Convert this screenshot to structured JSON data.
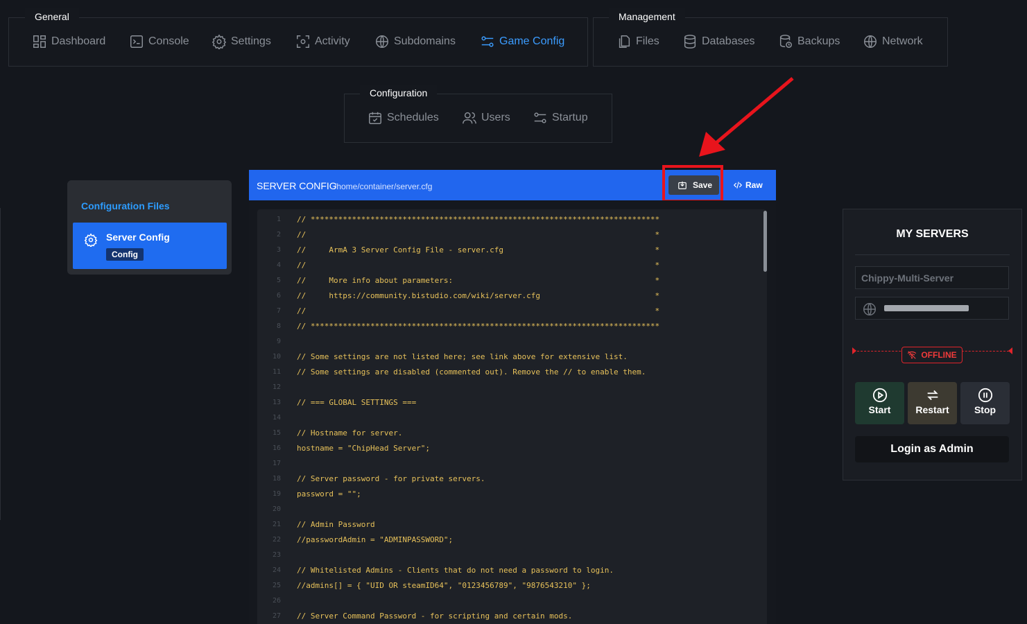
{
  "nav_groups": {
    "general": {
      "title": "General",
      "items": [
        "Dashboard",
        "Console",
        "Settings",
        "Activity",
        "Subdomains",
        "Game Config"
      ],
      "active": "Game Config"
    },
    "management": {
      "title": "Management",
      "items": [
        "Files",
        "Databases",
        "Backups",
        "Network"
      ]
    },
    "configuration": {
      "title": "Configuration",
      "items": [
        "Schedules",
        "Users",
        "Startup"
      ]
    }
  },
  "config_files": {
    "title": "Configuration Files",
    "item_label": "Server Config",
    "item_badge": "Config"
  },
  "editor": {
    "title": "SERVER CONFIG",
    "path": "/home/container/server.cfg",
    "save_label": "Save",
    "raw_label": "Raw",
    "lines": [
      "// ****************************************************************************",
      "//                                                                            *",
      "//     ArmA 3 Server Config File - server.cfg                                 *",
      "//                                                                            *",
      "//     More info about parameters:                                            *",
      "//     https://community.bistudio.com/wiki/server.cfg                         *",
      "//                                                                            *",
      "// ****************************************************************************",
      "",
      "// Some settings are not listed here; see link above for extensive list.",
      "// Some settings are disabled (commented out). Remove the // to enable them.",
      "",
      "// === GLOBAL SETTINGS ===",
      "",
      "// Hostname for server.",
      "hostname = \"ChipHead Server\";",
      "",
      "// Server password - for private servers.",
      "password = \"\";",
      "",
      "// Admin Password",
      "//passwordAdmin = \"ADMINPASSWORD\";",
      "",
      "// Whitelisted Admins - Clients that do not need a password to login.",
      "//admins[] = { \"UID OR steamID64\", \"0123456789\", \"9876543210\" };",
      "",
      "// Server Command Password - for scripting and certain mods."
    ]
  },
  "servers": {
    "title": "MY SERVERS",
    "server_name": "Chippy-Multi-Server",
    "status": "OFFLINE",
    "start_label": "Start",
    "restart_label": "Restart",
    "stop_label": "Stop",
    "login_label": "Login as Admin"
  },
  "colors": {
    "accent": "#2166ee",
    "active_nav": "#3b9cff",
    "offline": "#e0242b",
    "code": "#e7c15a"
  }
}
